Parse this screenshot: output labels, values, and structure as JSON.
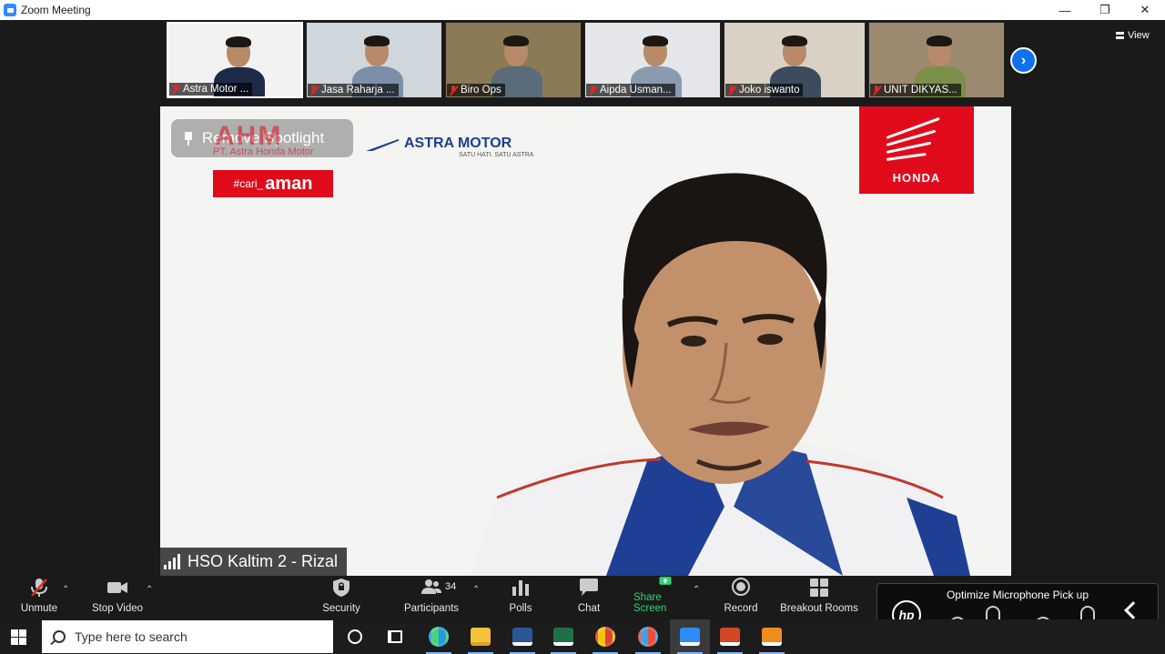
{
  "window": {
    "title": "Zoom Meeting"
  },
  "gallery": {
    "participants": [
      {
        "name": "Astra Motor ...",
        "bg": "#f2f2f2",
        "shirt": "#1e2a48",
        "active": true
      },
      {
        "name": "Jasa Raharja ...",
        "bg": "#cfd6dc",
        "shirt": "#7b8faa",
        "active": false
      },
      {
        "name": "Biro Ops",
        "bg": "#8a7a56",
        "shirt": "#5a6b7a",
        "active": false
      },
      {
        "name": "Aipda Usman...",
        "bg": "#e4e6ea",
        "shirt": "#8a9bb0",
        "active": false
      },
      {
        "name": "Joko iswanto",
        "bg": "#d9d2c4",
        "shirt": "#3c4c5c",
        "active": false
      },
      {
        "name": "UNIT DIKYAS...",
        "bg": "#9c8a70",
        "shirt": "#7c8f46",
        "active": false
      }
    ],
    "next_icon": "chevron-right-icon"
  },
  "view_button": {
    "label": "View"
  },
  "spotlight": {
    "remove_label": "Remove Spotlight",
    "ahm_logo": "AHM",
    "ahm_sub": "PT. Astra Honda Motor",
    "campaign_prefix": "#cari_",
    "campaign_word": "aman",
    "astra_logo": "ASTRA MOTOR",
    "astra_tag": "SATU HATI. SATU ASTRA",
    "honda_logo": "HONDA",
    "speaker_name": "HSO Kaltim 2 - Rizal"
  },
  "toolbar": {
    "unmute": "Unmute",
    "stop_video": "Stop Video",
    "security": "Security",
    "participants": "Participants",
    "participants_count": "34",
    "polls": "Polls",
    "chat": "Chat",
    "share_screen": "Share Screen",
    "record": "Record",
    "breakout_rooms": "Breakout Rooms"
  },
  "hp_panel": {
    "title": "Optimize Microphone Pick up",
    "logo": "hp"
  },
  "taskbar": {
    "search_placeholder": "Type here to search",
    "apps": [
      "cortana-icon",
      "task-view-icon",
      "edge-icon",
      "file-explorer-icon",
      "word-icon",
      "excel-icon",
      "chrome-icon",
      "paint-icon",
      "zoom-icon",
      "powerpoint-icon",
      "media-player-icon"
    ]
  },
  "colors": {
    "zoom_blue": "#0e72ed",
    "share_green": "#2ed573",
    "brand_red": "#e10a1b",
    "astra_blue": "#1c3f8f"
  }
}
